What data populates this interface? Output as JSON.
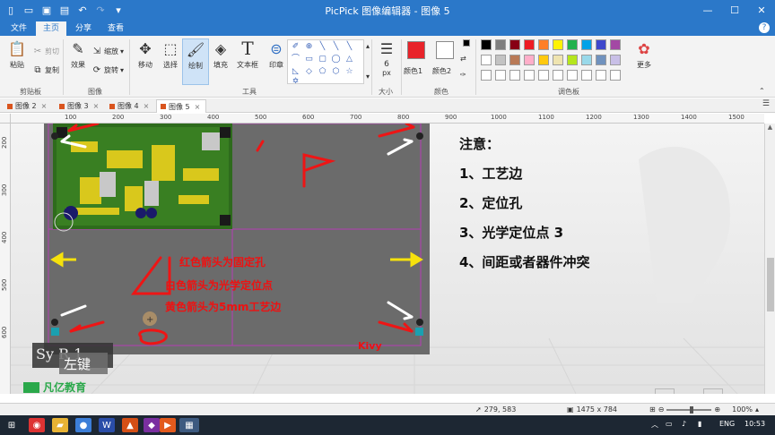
{
  "window": {
    "title": "PicPick 图像编辑器 - 图像 5"
  },
  "ribbon_tabs": [
    "文件",
    "主页",
    "分享",
    "查看"
  ],
  "ribbon": {
    "clipboard": {
      "paste": "粘贴",
      "cut": "剪切",
      "copy": "复制",
      "label": "剪贴板"
    },
    "image": {
      "effects": "效果",
      "resize": "缩放",
      "rotate": "旋转",
      "label": "图像"
    },
    "tools": {
      "move": "移动",
      "select": "选择",
      "draw": "绘制",
      "fill": "填充",
      "text": "文本框",
      "stamp": "印章",
      "label": "工具"
    },
    "size": {
      "value": "6",
      "unit": "px",
      "label": "大小"
    },
    "color": {
      "color1": "颜色1",
      "color2": "颜色2",
      "label": "颜色"
    },
    "palette": {
      "label": "调色板",
      "more": "更多"
    }
  },
  "colors": {
    "color1": "#e8232a",
    "color2": "#ffffff",
    "palette": [
      "#000000",
      "#7f7f7f",
      "#880015",
      "#ed1c24",
      "#ff7f27",
      "#fff200",
      "#22b14c",
      "#00a2e8",
      "#3f48cc",
      "#a349a4",
      "#ffffff",
      "#c3c3c3",
      "#b97a57",
      "#ffaec9",
      "#ffc90e",
      "#efe4b0",
      "#b5e61d",
      "#99d9ea",
      "#7092be",
      "#c8bfe7"
    ]
  },
  "doc_tabs": [
    "图像 2",
    "图像 3",
    "图像 4",
    "图像 5"
  ],
  "rulers": {
    "h": [
      "100",
      "200",
      "300",
      "400",
      "500",
      "600",
      "700",
      "800",
      "900",
      "1000",
      "1100",
      "1200",
      "1300",
      "1400",
      "1500"
    ],
    "v": [
      "200",
      "300",
      "400",
      "500",
      "600"
    ]
  },
  "notes": {
    "title": "注意：",
    "items": [
      "1、工艺边",
      "2、定位孔",
      "3、光学定位点 3",
      "4、间距或者器件冲突"
    ]
  },
  "board_labels": {
    "red": "红色箭头为固定孔",
    "white": "白色箭头为光学定位点",
    "yellow": "黄色箭头为5mm工艺边",
    "signature": "Kivy"
  },
  "overlays": {
    "sys": "Sy   R   1",
    "left": "左键"
  },
  "watermark": "凡亿教育",
  "status": {
    "cursor": "279, 583",
    "size": "1475 x 784",
    "zoom": "100%"
  },
  "taskbar": {
    "lang": "ENG",
    "time": "10:53"
  }
}
